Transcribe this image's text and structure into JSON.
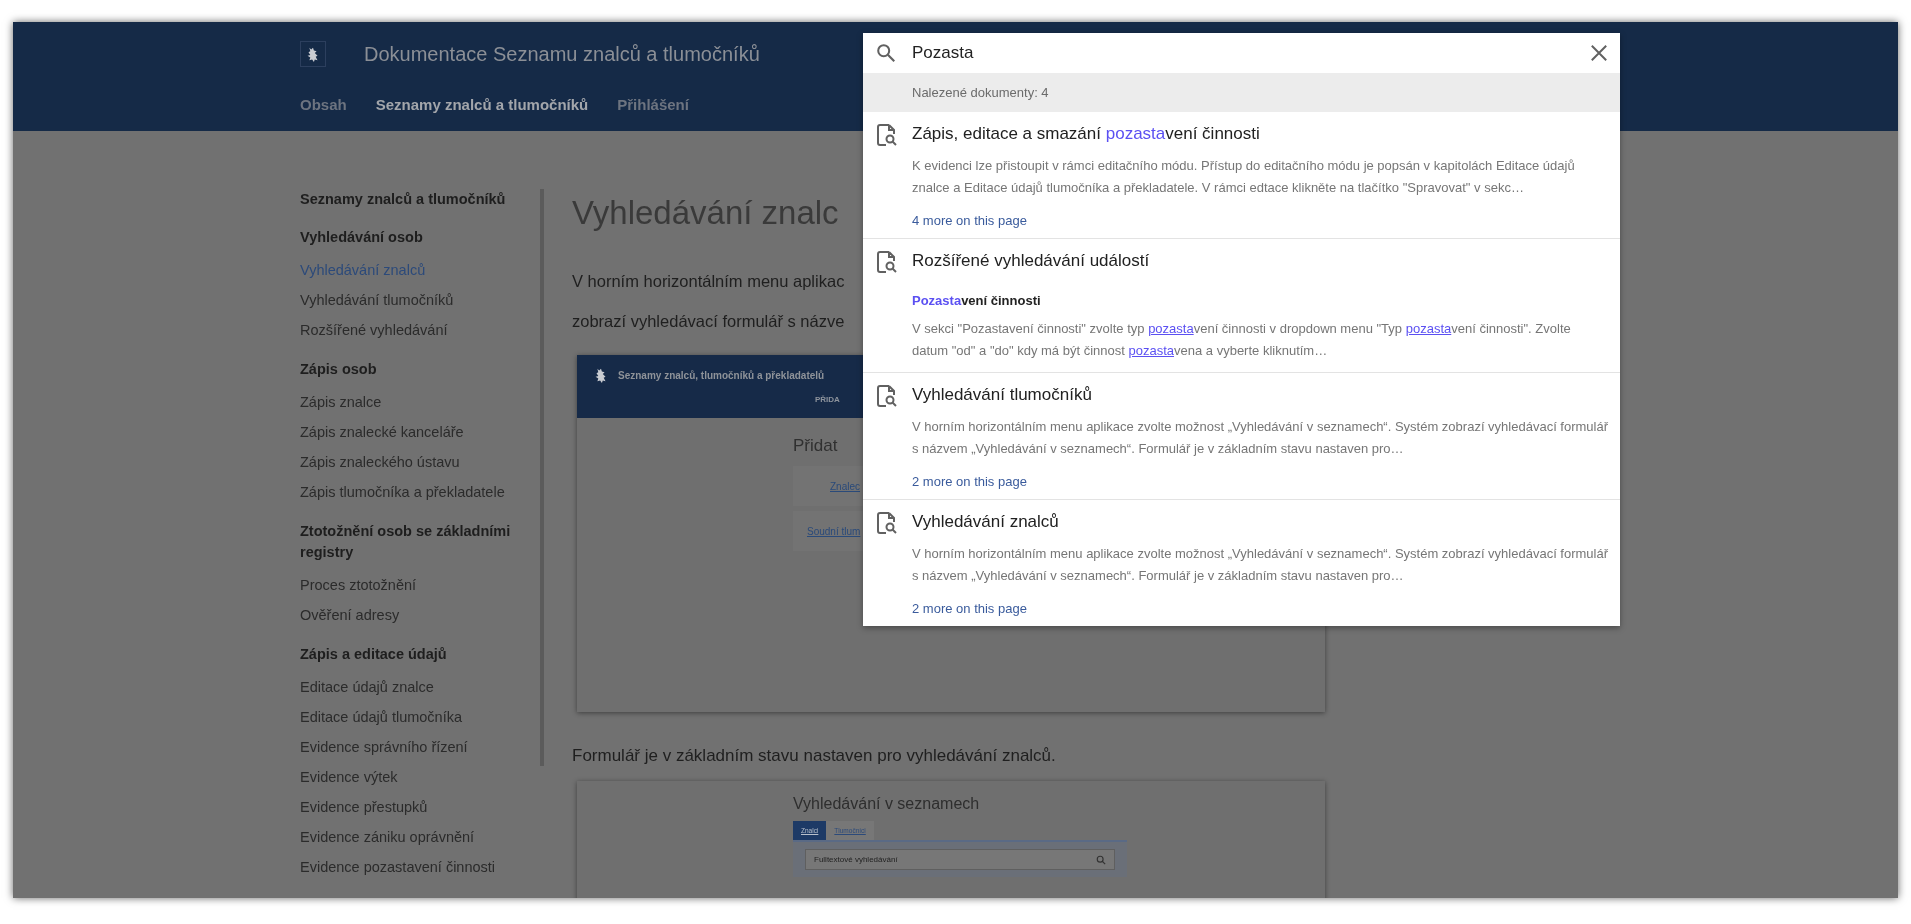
{
  "header": {
    "title": "Dokumentace Seznamu znalců a tlumočníků",
    "nav": [
      {
        "label": "Obsah",
        "selected": false
      },
      {
        "label": "Seznamy znalců a tlumočníků",
        "selected": true
      },
      {
        "label": "Přihlášení",
        "selected": false
      }
    ]
  },
  "sidebar": {
    "title": "Seznamy znalců a tlumočníků",
    "groups": [
      {
        "heading": "Vyhledávání osob",
        "items": [
          {
            "label": "Vyhledávání znalců",
            "selected": true
          },
          {
            "label": "Vyhledávání tlumočníků",
            "selected": false
          },
          {
            "label": "Rozšířené vyhledávání",
            "selected": false
          }
        ]
      },
      {
        "heading": "Zápis osob",
        "items": [
          {
            "label": "Zápis znalce",
            "selected": false
          },
          {
            "label": "Zápis znalecké kanceláře",
            "selected": false
          },
          {
            "label": "Zápis znaleckého ústavu",
            "selected": false
          },
          {
            "label": "Zápis tlumočníka a překladatele",
            "selected": false
          }
        ]
      },
      {
        "heading": "Ztotožnění osob se základními registry",
        "items": [
          {
            "label": "Proces ztotožnění",
            "selected": false
          },
          {
            "label": "Ověření adresy",
            "selected": false
          }
        ]
      },
      {
        "heading": "Zápis a editace údajů",
        "items": [
          {
            "label": "Editace údajů znalce",
            "selected": false
          },
          {
            "label": "Editace údajů tlumočníka",
            "selected": false
          },
          {
            "label": "Evidence správního řízení",
            "selected": false
          },
          {
            "label": "Evidence výtek",
            "selected": false
          },
          {
            "label": "Evidence přestupků",
            "selected": false
          },
          {
            "label": "Evidence zániku oprávnění",
            "selected": false
          },
          {
            "label": "Evidence pozastavení činnosti",
            "selected": false
          }
        ]
      }
    ]
  },
  "content": {
    "heading": "Vyhledávání znalc",
    "paragraph_lines": [
      "V horním horizontálním menu aplikac",
      "zobrazí vyhledávací formulář s názve"
    ],
    "figure_1": {
      "app_title": "Seznamy znalců, tlumočníků a překladatelů",
      "nav_label": "PŘIDA",
      "heading": "Přidat",
      "links": [
        "Znalec",
        "Soudní tlum"
      ]
    },
    "paragraph_2": "Formulář je v základním stavu nastaven pro vyhledávání znalců.",
    "figure_2": {
      "heading": "Vyhledávání v seznamech",
      "tabs": [
        {
          "label": "Znalci",
          "selected": true
        },
        {
          "label": "Tlumočníci",
          "selected": false
        }
      ],
      "search_placeholder": "Fulltextové vyhledávání"
    }
  },
  "search": {
    "query": "Pozasta",
    "count": "Nalezené dokumenty: 4",
    "results": [
      {
        "title": [
          {
            "text": "Zápis, editace a smazání ",
            "match": false
          },
          {
            "text": "pozasta",
            "match": true
          },
          {
            "text": "vení činnosti",
            "match": false
          }
        ],
        "snippet": [
          {
            "text": "K evidenci lze přistoupit v rámci editačního módu. Přístup do editačního módu je popsán v kapitolách Editace údajů znalce a Editace údajů tlumočníka a překladatele. V rámci edtace klikněte na tlačítko \"Spravovat\" v sekc…",
            "match": false
          }
        ],
        "more": "4 more on this page"
      },
      {
        "title": [
          {
            "text": "Rozšířené vyhledávání událostí",
            "match": false
          }
        ],
        "subheading": [
          {
            "text": "Pozasta",
            "match": true
          },
          {
            "text": "vení činnosti",
            "match": false
          }
        ],
        "snippet": [
          {
            "text": "V sekci \"Pozastavení činnosti\" zvolte typ ",
            "match": false
          },
          {
            "text": "pozasta",
            "match": true
          },
          {
            "text": "vení činnosti v dropdown menu \"Typ ",
            "match": false
          },
          {
            "text": "pozasta",
            "match": true
          },
          {
            "text": "vení činnosti\". Zvolte datum \"od\" a \"do\" kdy má být činnost ",
            "match": false
          },
          {
            "text": "pozasta",
            "match": true
          },
          {
            "text": "vena a vyberte kliknutím…",
            "match": false
          }
        ]
      },
      {
        "title": [
          {
            "text": "Vyhledávání tlumočníků",
            "match": false
          }
        ],
        "snippet": [
          {
            "text": "V horním horizontálním menu aplikace zvolte možnost „Vyhledávání v seznamech“. Systém zobrazí vyhledávací formulář s názvem „Vyhledávání v seznamech“. Formulář je v základním stavu nastaven pro…",
            "match": false
          }
        ],
        "more": "2 more on this page"
      },
      {
        "title": [
          {
            "text": "Vyhledávání znalců",
            "match": false
          }
        ],
        "snippet": [
          {
            "text": "V horním horizontálním menu aplikace zvolte možnost „Vyhledávání v seznamech“. Systém zobrazí vyhledávací formulář s názvem „Vyhledávání v seznamech“. Formulář je v základním stavu nastaven pro…",
            "match": false
          }
        ],
        "more": "2 more on this page"
      }
    ]
  }
}
